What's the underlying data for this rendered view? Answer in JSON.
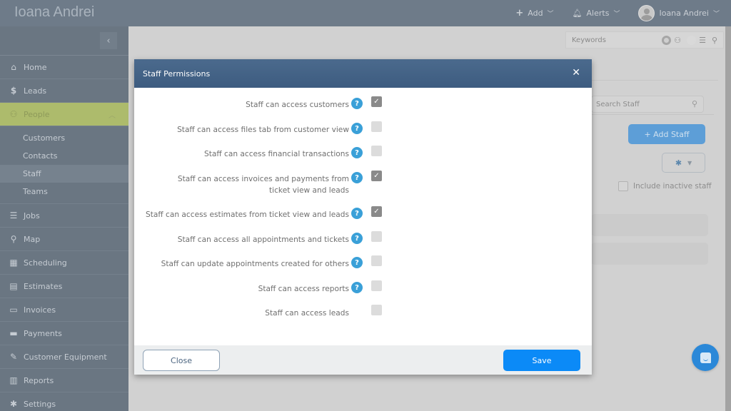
{
  "header": {
    "brand": "Ioana Andrei",
    "add_label": "Add",
    "alerts_label": "Alerts",
    "user_name": "Ioana Andrei"
  },
  "sidebar": {
    "collapse_glyph": "‹",
    "items": [
      {
        "label": "Home",
        "icon": "home-icon",
        "glyph": "⌂"
      },
      {
        "label": "Leads",
        "icon": "dollar-icon",
        "glyph": "$"
      },
      {
        "label": "People",
        "icon": "people-icon",
        "glyph": "⚇",
        "active": true,
        "expanded": true
      },
      {
        "label": "Jobs",
        "icon": "list-icon",
        "glyph": "☰"
      },
      {
        "label": "Map",
        "icon": "map-pin-icon",
        "glyph": "⚲"
      },
      {
        "label": "Scheduling",
        "icon": "calendar-icon",
        "glyph": "▦"
      },
      {
        "label": "Estimates",
        "icon": "calculator-icon",
        "glyph": "▤"
      },
      {
        "label": "Invoices",
        "icon": "money-icon",
        "glyph": "▭"
      },
      {
        "label": "Payments",
        "icon": "credit-card-icon",
        "glyph": "▬"
      },
      {
        "label": "Customer Equipment",
        "icon": "wrench-icon",
        "glyph": "✎"
      },
      {
        "label": "Reports",
        "icon": "bar-chart-icon",
        "glyph": "▥"
      },
      {
        "label": "Settings",
        "icon": "gear-icon",
        "glyph": "✱"
      }
    ],
    "people_sub": [
      "Customers",
      "Contacts",
      "Staff",
      "Teams"
    ],
    "active_sub": "Staff"
  },
  "filter": {
    "keywords_placeholder": "Keywords"
  },
  "background": {
    "search_placeholder": "Search Staff",
    "add_staff_label": "+ Add Staff",
    "include_inactive_label": "Include inactive staff",
    "include_inactive_checked": false
  },
  "modal": {
    "title": "Staff Permissions",
    "close_glyph": "✕",
    "permissions": [
      {
        "label": "Staff can access customers",
        "help": true,
        "checked": true
      },
      {
        "label": "Staff can access files tab from customer view",
        "help": true,
        "checked": false
      },
      {
        "label": "Staff can access financial transactions",
        "help": true,
        "checked": false
      },
      {
        "label": "Staff can access invoices and payments from ticket view and leads",
        "help": true,
        "checked": true
      },
      {
        "label": "Staff can access estimates from ticket view and leads",
        "help": true,
        "checked": true
      },
      {
        "label": "Staff can access all appointments and tickets",
        "help": true,
        "checked": false
      },
      {
        "label": "Staff can update appointments created for others",
        "help": true,
        "checked": false
      },
      {
        "label": "Staff can access reports",
        "help": true,
        "checked": false
      },
      {
        "label": "Staff can access leads",
        "help": false,
        "checked": false
      }
    ],
    "close_button": "Close",
    "save_button": "Save"
  },
  "colors": {
    "header_bg": "#6e7b89",
    "sidebar_bg": "#6a7682",
    "active_nav": "#adbb6c",
    "modal_header": "#45648a",
    "save_button": "#0b8af7",
    "help_icon": "#3aa0d8"
  }
}
